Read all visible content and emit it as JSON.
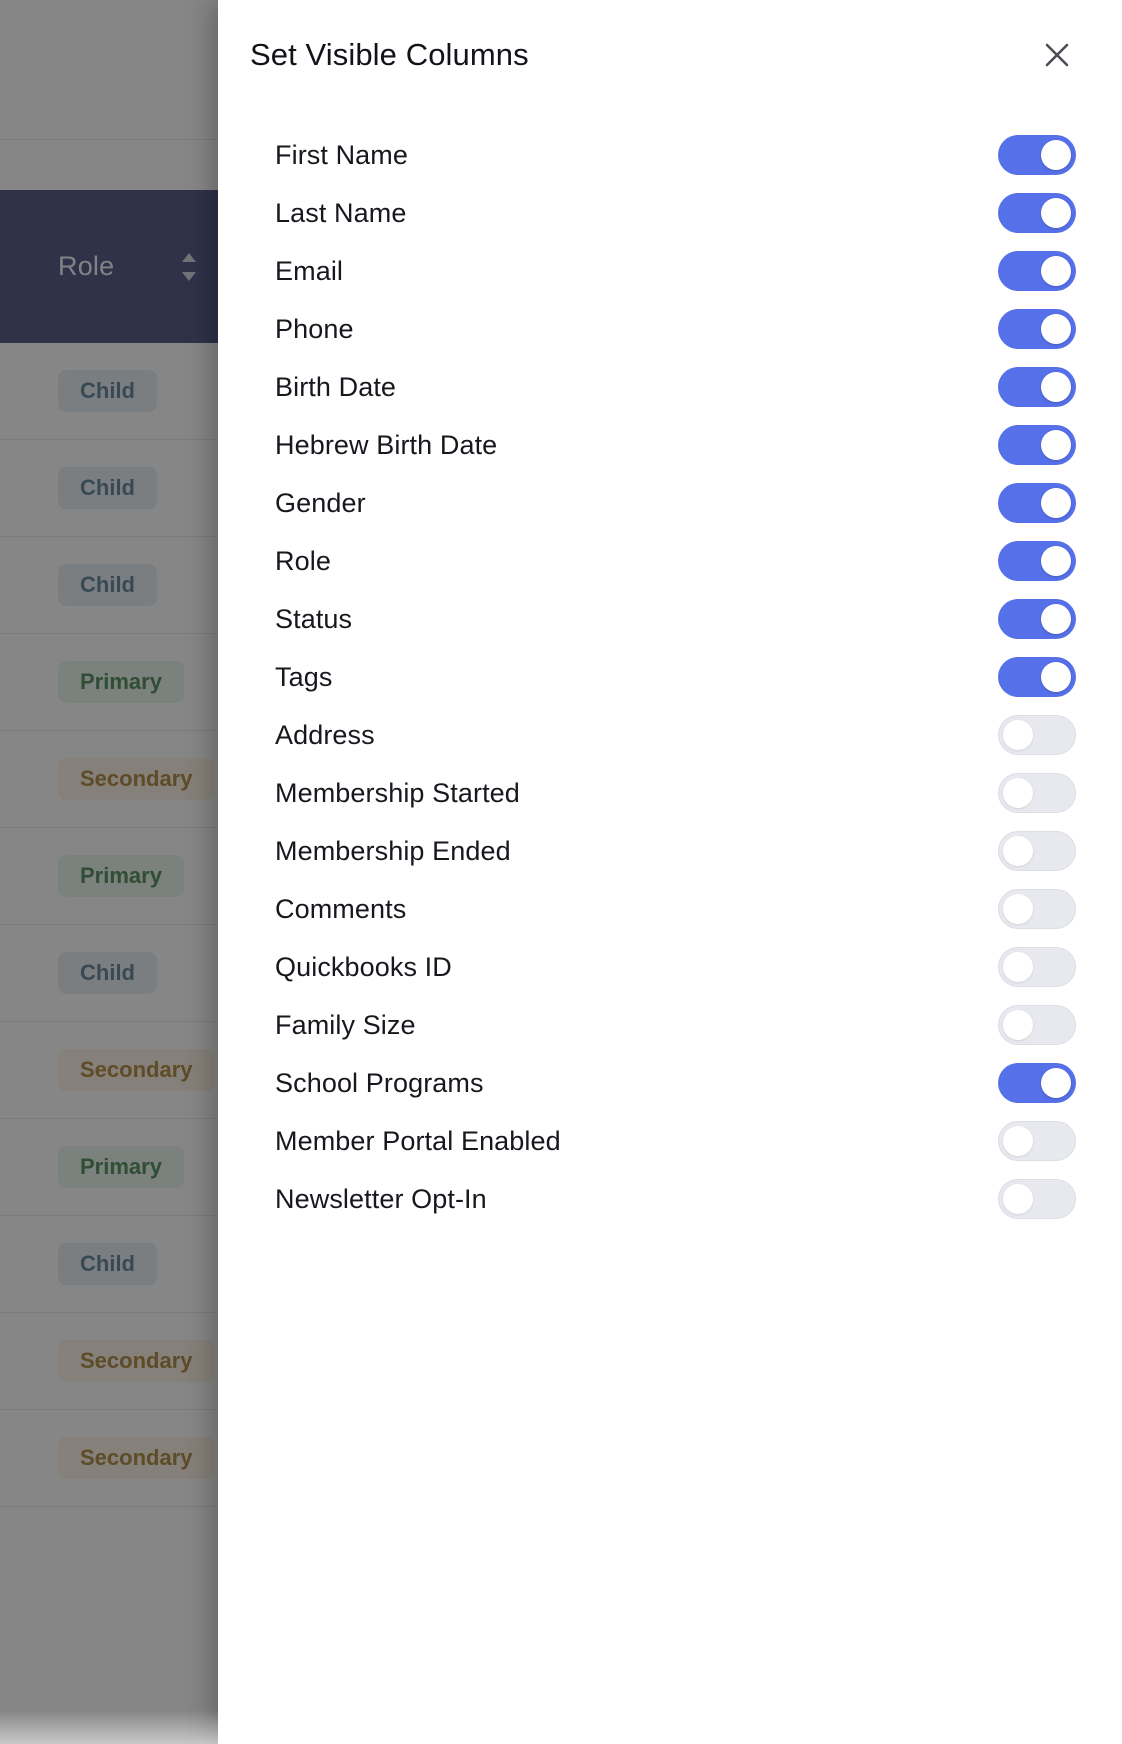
{
  "modal": {
    "title": "Set Visible Columns",
    "close_icon": "close-icon",
    "columns": [
      {
        "label": "First Name",
        "enabled": true
      },
      {
        "label": "Last Name",
        "enabled": true
      },
      {
        "label": "Email",
        "enabled": true
      },
      {
        "label": "Phone",
        "enabled": true
      },
      {
        "label": "Birth Date",
        "enabled": true
      },
      {
        "label": "Hebrew Birth Date",
        "enabled": true
      },
      {
        "label": "Gender",
        "enabled": true
      },
      {
        "label": "Role",
        "enabled": true
      },
      {
        "label": "Status",
        "enabled": true
      },
      {
        "label": "Tags",
        "enabled": true
      },
      {
        "label": "Address",
        "enabled": false
      },
      {
        "label": "Membership Started",
        "enabled": false
      },
      {
        "label": "Membership Ended",
        "enabled": false
      },
      {
        "label": "Comments",
        "enabled": false
      },
      {
        "label": "Quickbooks ID",
        "enabled": false
      },
      {
        "label": "Family Size",
        "enabled": false
      },
      {
        "label": "School Programs",
        "enabled": true
      },
      {
        "label": "Member Portal Enabled",
        "enabled": false
      },
      {
        "label": "Newsletter Opt-In",
        "enabled": false
      }
    ]
  },
  "background_table": {
    "column_header": {
      "label": "Role",
      "sort_icon": "sort-chevrons-icon"
    },
    "rows": [
      {
        "role": "Child"
      },
      {
        "role": "Child"
      },
      {
        "role": "Child"
      },
      {
        "role": "Primary"
      },
      {
        "role": "Secondary"
      },
      {
        "role": "Primary"
      },
      {
        "role": "Child"
      },
      {
        "role": "Secondary"
      },
      {
        "role": "Primary"
      },
      {
        "role": "Child"
      },
      {
        "role": "Secondary"
      },
      {
        "role": "Secondary"
      }
    ]
  },
  "colors": {
    "accent_on": "#5570e8",
    "track_off": "#e8e9ee",
    "header_navy": "#1b2260",
    "badge_child_text": "#34607d",
    "badge_primary_text": "#1f6b2c",
    "badge_secondary_text": "#97650a",
    "scrim": "rgba(60,60,60,0.62)"
  }
}
